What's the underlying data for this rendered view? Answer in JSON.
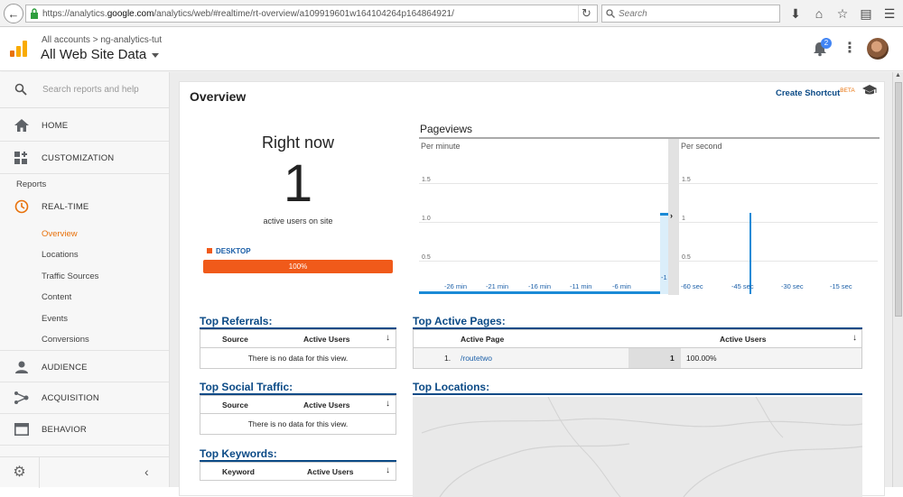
{
  "browser": {
    "url_prefix": "https://analytics.",
    "url_domain": "google.com",
    "url_suffix": "/analytics/web/#realtime/rt-overview/a109919601w164104264p164864921/",
    "search_placeholder": "Search"
  },
  "header": {
    "crumb_root": "All accounts",
    "crumb_separator": ">",
    "crumb_account": "ng-analytics-tut",
    "view_name": "All Web Site Data",
    "notification_count": "2"
  },
  "sidebar": {
    "search_placeholder": "Search reports and help",
    "items": [
      {
        "label": "HOME",
        "icon": "home-icon"
      },
      {
        "label": "CUSTOMIZATION",
        "icon": "dashboard-icon"
      }
    ],
    "section_label": "Reports",
    "realtime": {
      "label": "REAL-TIME",
      "icon": "clock-icon"
    },
    "realtime_sub": [
      "Overview",
      "Locations",
      "Traffic Sources",
      "Content",
      "Events",
      "Conversions"
    ],
    "lower_items": [
      {
        "label": "AUDIENCE",
        "icon": "person-icon"
      },
      {
        "label": "ACQUISITION",
        "icon": "acquisition-icon"
      },
      {
        "label": "BEHAVIOR",
        "icon": "behavior-icon"
      }
    ]
  },
  "overview": {
    "title": "Overview",
    "create_shortcut": "Create Shortcut",
    "beta": "BETA",
    "right_now_label": "Right now",
    "active_users": "1",
    "active_users_sub": "active users on site",
    "device_legend": "DESKTOP",
    "device_percent": "100%",
    "device_fraction": 1.0,
    "accent_color": "#f05a1a",
    "link_color": "#0b4a86"
  },
  "pageviews": {
    "title": "Pageviews",
    "per_minute_label": "Per minute",
    "per_second_label": "Per second",
    "minute_yticks": [
      "1.5",
      "1.0",
      "0.5"
    ],
    "minute_xticks": [
      "-26 min",
      "-21 min",
      "-16 min",
      "-11 min",
      "-6 min",
      "-1"
    ],
    "second_yticks": [
      "1.5",
      "1",
      "0.5"
    ],
    "second_xticks": [
      "-60 sec",
      "-45 sec",
      "-30 sec",
      "-15 sec"
    ],
    "minute_last_value": 1,
    "second_spike_at": -45,
    "second_spike_value": 1
  },
  "top_referrals": {
    "title": "Top Referrals:",
    "col_source": "Source",
    "col_active": "Active Users",
    "empty": "There is no data for this view."
  },
  "top_social": {
    "title": "Top Social Traffic:",
    "col_source": "Source",
    "col_active": "Active Users",
    "empty": "There is no data for this view."
  },
  "top_keywords": {
    "title": "Top Keywords:",
    "col_keyword": "Keyword",
    "col_active": "Active Users"
  },
  "top_pages": {
    "title": "Top Active Pages:",
    "col_page": "Active Page",
    "col_active": "Active Users",
    "rows": [
      {
        "rank": "1.",
        "page": "/routetwo",
        "count": "1",
        "percent": "100.00%"
      }
    ]
  },
  "top_locations": {
    "title": "Top Locations:"
  }
}
